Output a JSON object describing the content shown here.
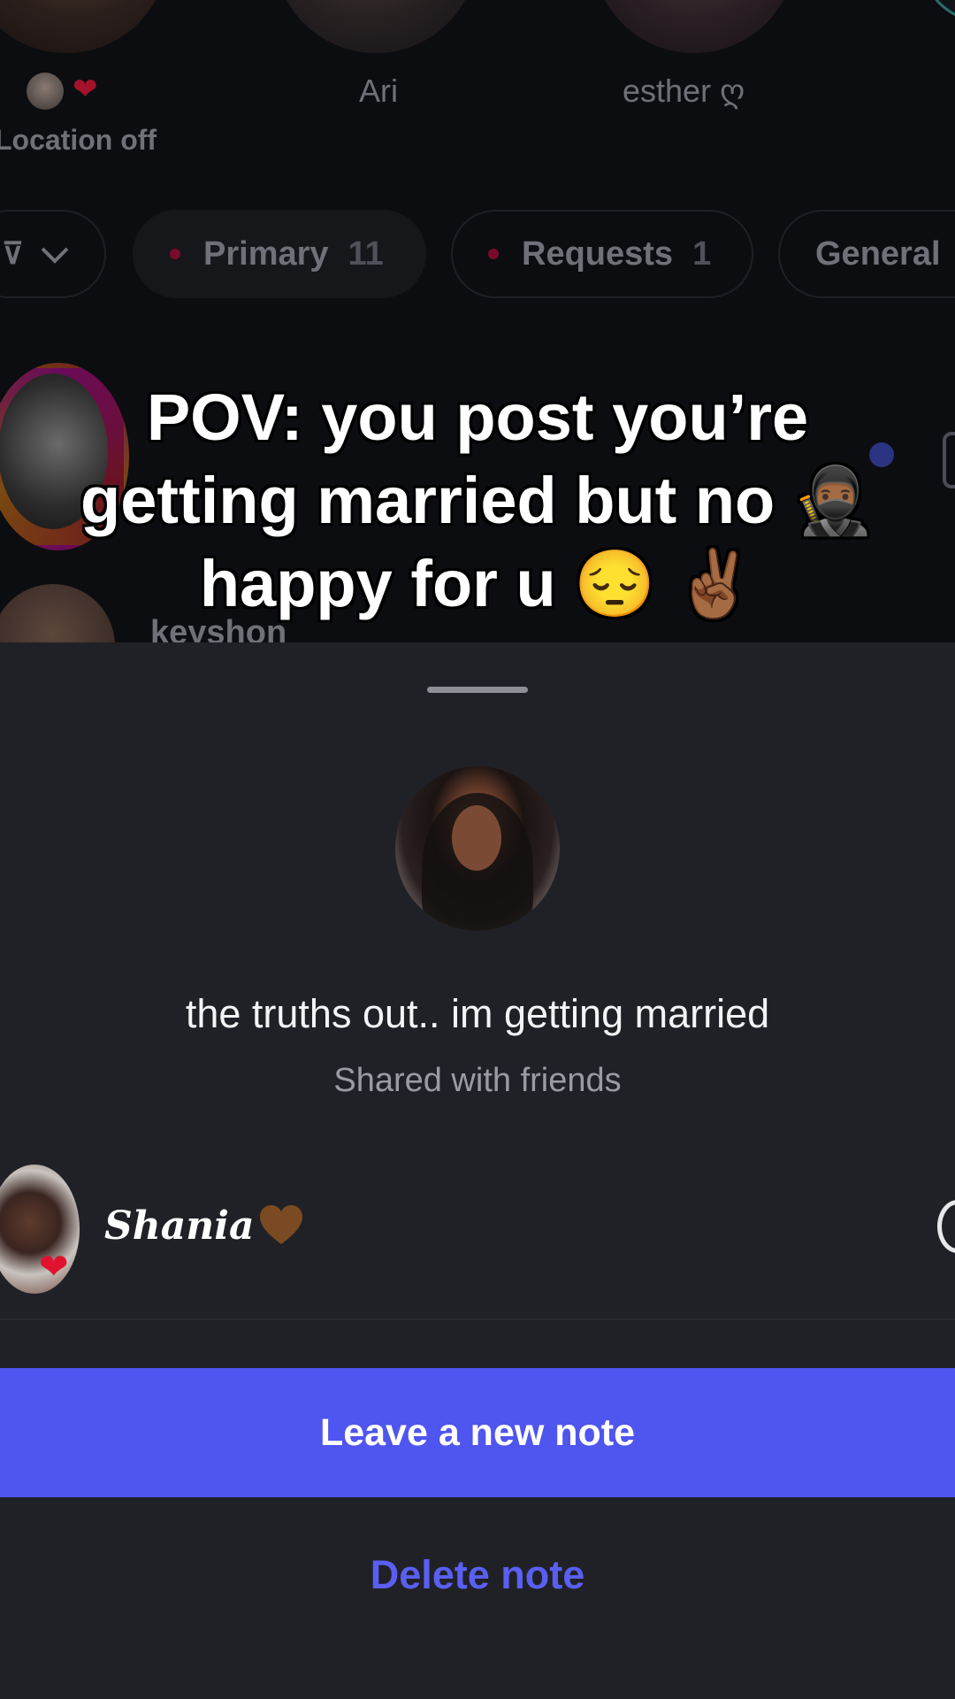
{
  "stories": [
    {
      "name": "Ari"
    },
    {
      "name": "esther ღ"
    }
  ],
  "own_story": {
    "status": "Location off"
  },
  "tabs": {
    "primary_label": "Primary",
    "primary_count": "11",
    "requests_label": "Requests",
    "requests_count": "1",
    "general_label": "General"
  },
  "thread_partial_name": "keyshon",
  "overlay_caption": "POV: you post you’re getting married but no 🥷🏾 happy for u 😔 ✌🏾",
  "note": {
    "text": "the truths out.. im getting married",
    "audience": "Shared with friends"
  },
  "reaction": {
    "name": "Shania"
  },
  "actions": {
    "leave_new_note": "Leave a new note",
    "delete_note": "Delete note"
  },
  "colors": {
    "accent": "#4f55ef",
    "delete_text": "#5a5ff2",
    "sheet_bg": "#202127",
    "heart": "#e0122f"
  },
  "icons": [
    "heart-icon",
    "chevron-down-icon",
    "brown-heart-icon",
    "reply-icon",
    "camera-icon"
  ]
}
